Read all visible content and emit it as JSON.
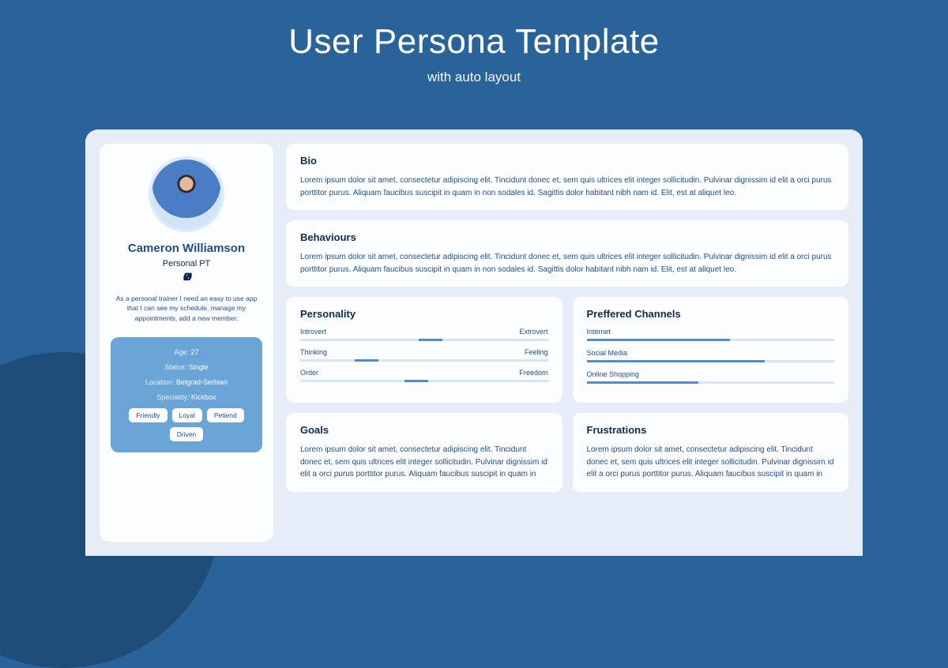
{
  "header": {
    "title": "User Persona Template",
    "subtitle": "with auto layout"
  },
  "persona": {
    "name": "Cameron Williamson",
    "role": "Personal PT",
    "quote": "As a personal trainer I need an easy to use app that I can see my schedule, manage my appointments, add a new member.",
    "details": {
      "age_label": "Age:",
      "age_value": "27",
      "status_label": "Status:",
      "status_value": "Single",
      "location_label": "Location:",
      "location_value": "Belgrad-Serbian",
      "speciality_label": "Speciality:",
      "speciality_value": "Kickbox"
    },
    "tags": [
      "Friendly",
      "Loyal",
      "Petiend",
      "Driven"
    ]
  },
  "sections": {
    "bio": {
      "title": "Bio",
      "body": "Lorem ipsum dolor sit amet, consectetur adipiscing elit. Tincidunt donec et, sem quis ultrices elit integer sollicitudin. Pulvinar dignissim id elit a orci purus porttitor purus. Aliquam faucibus suscipit in quam in non sodales id. Sagittis dolor habitant nibh nam id. Elit, est at aliquet leo."
    },
    "behaviours": {
      "title": "Behaviours",
      "body": "Lorem ipsum dolor sit amet, consectetur adipiscing elit. Tincidunt donec et, sem quis ultrices elit integer sollicitudin. Pulvinar dignissim id elit a orci purus porttitor purus. Aliquam faucibus suscipit in quam in non sodales id. Sagittis dolor habitant nibh nam id. Elit, est at aliquet leo."
    },
    "personality": {
      "title": "Personality",
      "traits": [
        {
          "left": "Introvert",
          "right": "Extrovert",
          "pos": 48
        },
        {
          "left": "Thinking",
          "right": "Feeling",
          "pos": 22
        },
        {
          "left": "Order",
          "right": "Freedom",
          "pos": 42
        }
      ]
    },
    "channels": {
      "title": "Preffered Channels",
      "items": [
        {
          "label": "Internet",
          "pct": 58
        },
        {
          "label": "Social Media",
          "pct": 72
        },
        {
          "label": "Online Shopping",
          "pct": 45
        }
      ]
    },
    "goals": {
      "title": "Goals",
      "body": "Lorem ipsum dolor sit amet, consectetur adipiscing elit. Tincidunt donec et, sem quis ultrices elit integer sollicitudin. Pulvinar dignissim id elit a orci purus porttitor purus. Aliquam faucibus suscipit in quam in"
    },
    "frustrations": {
      "title": "Frustrations",
      "body": "Lorem ipsum dolor sit amet, consectetur adipiscing elit. Tincidunt donec et, sem quis ultrices elit integer sollicitudin. Pulvinar dignissim id elit a orci purus porttitor purus. Aliquam faucibus suscipit in quam in"
    }
  }
}
